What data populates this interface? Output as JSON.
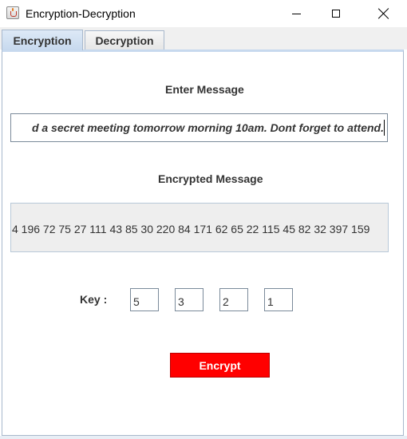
{
  "window": {
    "title": "Encryption-Decryption",
    "app_icon": "java-cup-icon"
  },
  "tabs": [
    {
      "label": "Encryption",
      "active": true
    },
    {
      "label": "Decryption",
      "active": false
    }
  ],
  "encryption": {
    "enter_label": "Enter Message",
    "message_value": "d a secret meeting tomorrow morning 10am. Dont forget to attend.",
    "encrypted_label": "Encrypted Message",
    "encrypted_value": "4 196 72 75 27 111 43 85 30 220 84 171 62 65 22 115 45 82 32 397 159",
    "key_label": "Key :",
    "keys": [
      "5",
      "3",
      "2",
      "1"
    ],
    "encrypt_label": "Encrypt"
  },
  "colors": {
    "encrypt_button": "#ff0000",
    "active_tab": "#c7d9ee"
  }
}
